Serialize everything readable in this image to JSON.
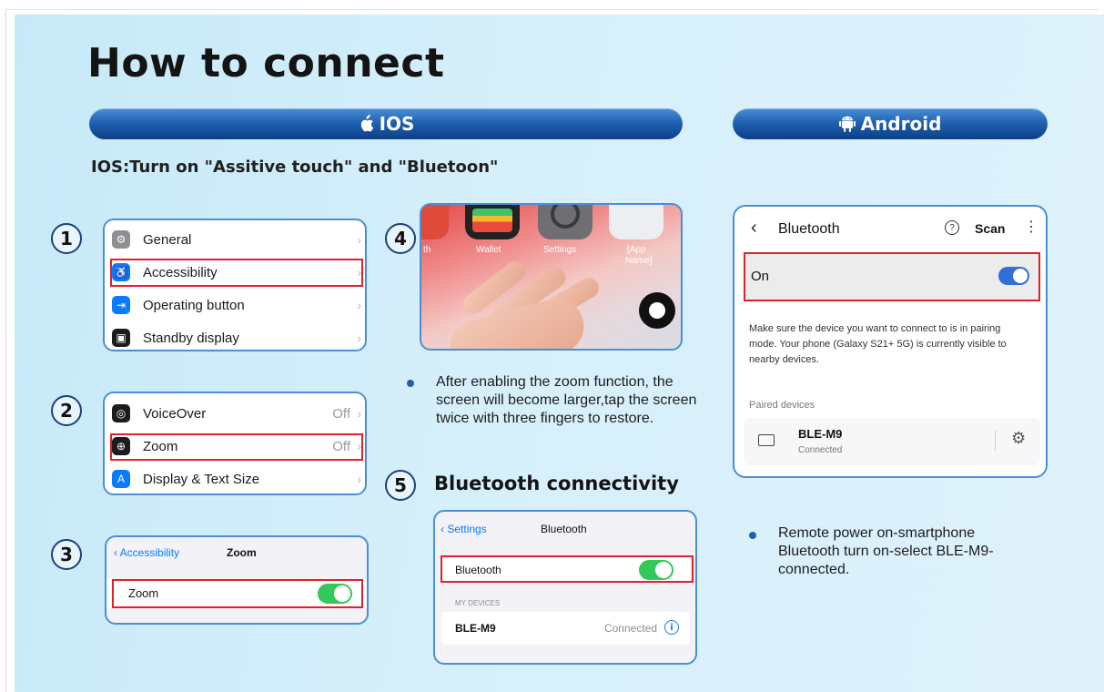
{
  "title": "How to connect",
  "ios_header": "IOS",
  "android_header": "Android",
  "subtitle": "IOS:Turn on \"Assitive touch\" and \"Bluetoon\"",
  "steps": [
    "1",
    "2",
    "3",
    "4",
    "5"
  ],
  "step1": {
    "items": [
      {
        "label": "General",
        "icon": "gear-icon",
        "color": "#8e8e93"
      },
      {
        "label": "Accessibility",
        "icon": "accessibility-icon",
        "color": "#0a7aff"
      },
      {
        "label": "Operating button",
        "icon": "operating-button-icon",
        "color": "#0a7aff"
      },
      {
        "label": "Standby display",
        "icon": "standby-display-icon",
        "color": "#1c1c1e"
      }
    ]
  },
  "step2": {
    "items": [
      {
        "label": "VoiceOver",
        "value": "Off",
        "icon": "voiceover-icon",
        "color": "#1c1c1e"
      },
      {
        "label": "Zoom",
        "value": "Off",
        "icon": "zoom-icon",
        "color": "#1c1c1e"
      },
      {
        "label": "Display & Text Size",
        "icon": "text-size-icon",
        "color": "#0a7aff"
      }
    ]
  },
  "step3": {
    "back_label": "Accessibility",
    "nav_title": "Zoom",
    "row_label": "Zoom",
    "toggle_on": true
  },
  "step4": {
    "app_labels": [
      "th",
      "Wallet",
      "Settings",
      "[App",
      "Name]"
    ],
    "bullet_text": "After enabling the zoom function, the screen will become larger,tap the screen twice with three fingers to restore."
  },
  "step5": {
    "heading": "Bluetooth connectivity",
    "back_label": "Settings",
    "nav_title": "Bluetooth",
    "row_label": "Bluetooth",
    "toggle_on": true,
    "section_label": "MY DEVICES",
    "device_name": "BLE-M9",
    "device_status": "Connected"
  },
  "android": {
    "nav_title": "Bluetooth",
    "scan_label": "Scan",
    "on_label": "On",
    "toggle_on": true,
    "info_text": "Make sure the device you want to connect to is in pairing mode. Your phone (Galaxy S21+ 5G) is currently visible to nearby devices.",
    "paired_label": "Paired devices",
    "device_name": "BLE-M9",
    "device_status": "Connected",
    "bullet_text": "Remote power on-smartphone Bluetooth turn on-select BLE-M9-connected."
  },
  "colors": {
    "accent_blue": "#1f5fb0",
    "highlight_red": "#e0202a",
    "ios_green": "#34c759",
    "android_blue": "#2f6fd6"
  }
}
